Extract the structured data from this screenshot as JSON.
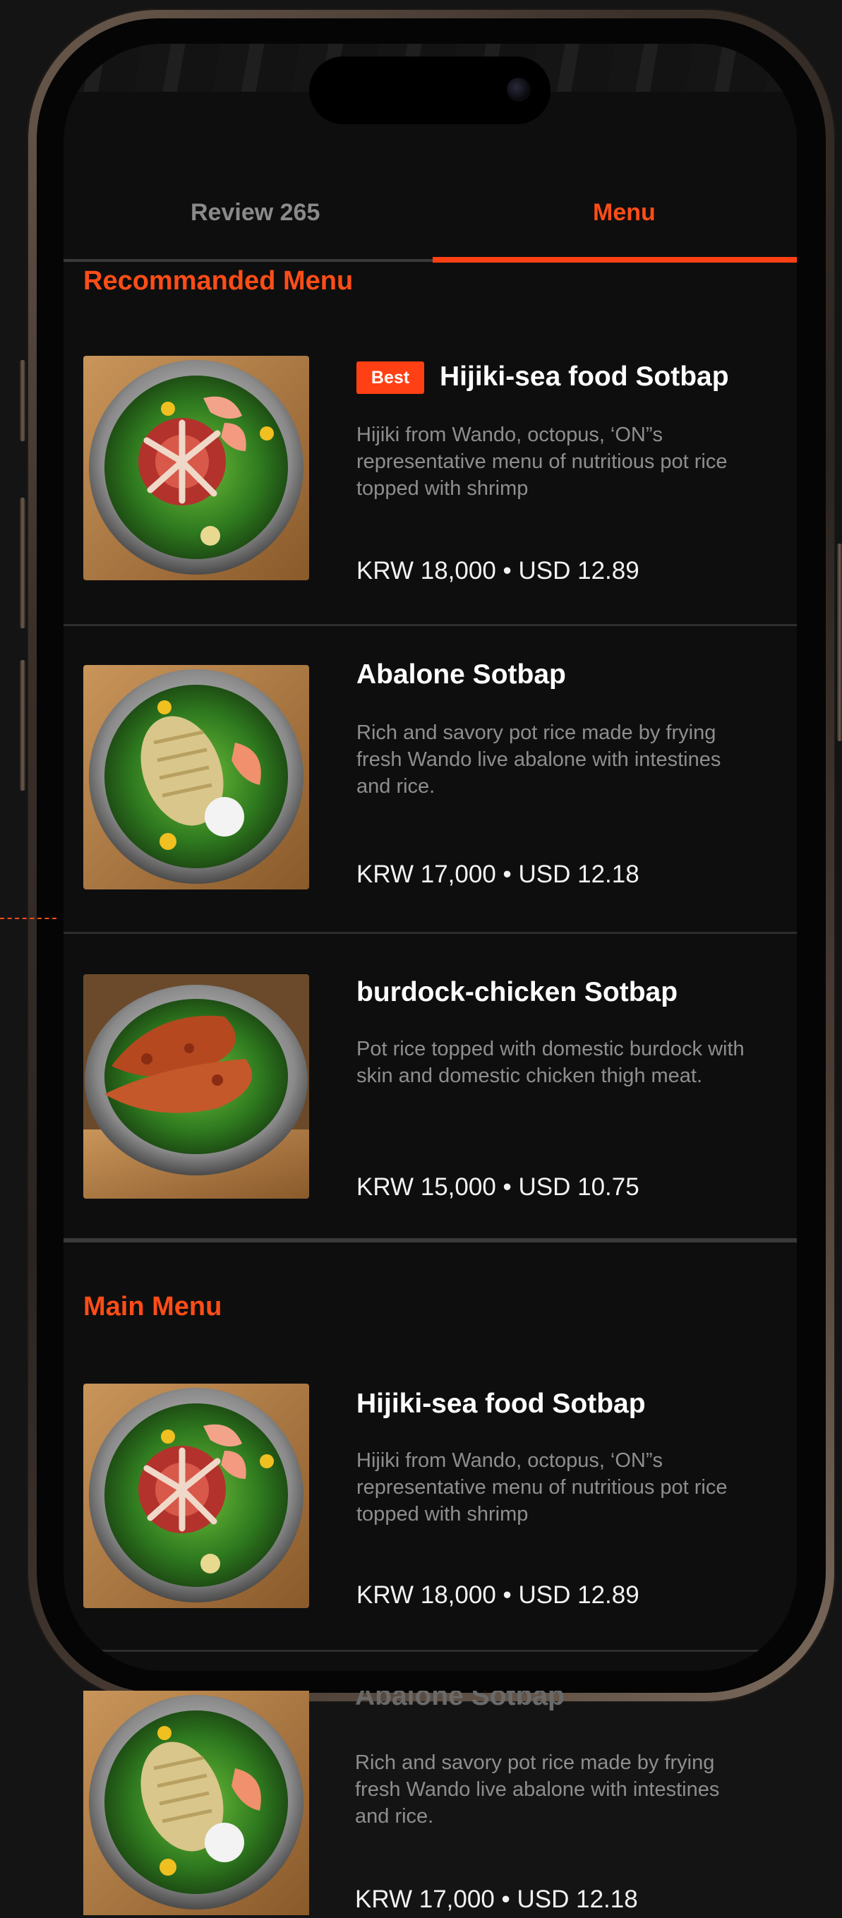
{
  "tabs": [
    {
      "label": "Review 265",
      "active": false
    },
    {
      "label": "Menu",
      "active": true
    }
  ],
  "recommended": {
    "title": "Recommanded Menu",
    "items": [
      {
        "badge": "Best",
        "name": "Hijiki-sea food Sotbap",
        "description": "Hijiki from Wando, octopus, ‘ON”s representative menu of nutritious pot rice topped with shrimp",
        "price": "KRW 18,000 • USD 12.89",
        "image_icon": "octopus-shrimp-pot-rice"
      },
      {
        "name": "Abalone Sotbap",
        "description": "Rich and savory pot rice made by frying fresh Wando live abalone with intestines and rice.",
        "price": "KRW 17,000 • USD 12.18",
        "image_icon": "abalone-pot-rice"
      },
      {
        "name": "burdock-chicken Sotbap",
        "description": "Pot rice topped with domestic burdock with skin and domestic chicken thigh meat.",
        "price": "KRW 15,000 • USD 10.75",
        "image_icon": "chicken-pot-rice"
      }
    ]
  },
  "main": {
    "title": "Main Menu",
    "items": [
      {
        "name": "Hijiki-sea food Sotbap",
        "description": "Hijiki from Wando, octopus, ‘ON”s representative menu of nutritious pot rice topped with shrimp",
        "price": "KRW 18,000 • USD 12.89",
        "image_icon": "octopus-shrimp-pot-rice"
      },
      {
        "name": "Abalone Sotbap",
        "description": "Rich and savory pot rice made by frying fresh Wando live abalone with intestines and rice.",
        "price": "KRW 17,000 • USD 12.18",
        "image_icon": "abalone-pot-rice"
      }
    ]
  },
  "colors": {
    "accent": "#ff4014",
    "background": "#0e0e0e",
    "text_primary": "#ffffff",
    "text_secondary": "#8e8e8e"
  }
}
